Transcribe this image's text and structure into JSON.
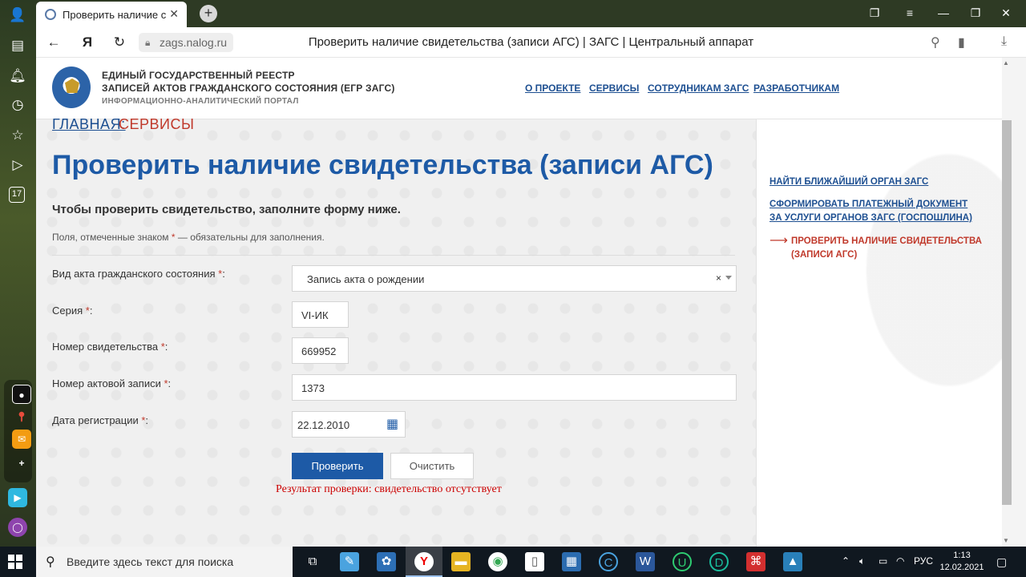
{
  "browser": {
    "tab_title": "Проверить наличие св",
    "tab_close": "✕",
    "url": "zags.nalog.ru",
    "page_title": "Проверить наличие свидетельства (записи АГС) | ЗАГС | Центральный аппарат",
    "new_tab": "+"
  },
  "header": {
    "brand_line1": "ЕДИНЫЙ ГОСУДАРСТВЕННЫЙ РЕЕСТР",
    "brand_line2": "ЗАПИСЕЙ АКТОВ ГРАЖДАНСКОГО СОСТОЯНИЯ (ЕГР ЗАГС)",
    "brand_line3": "ИНФОРМАЦИОННО-АНАЛИТИЧЕСКИЙ ПОРТАЛ",
    "nav": [
      "О ПРОЕКТЕ",
      "СЕРВИСЫ",
      "СОТРУДНИКАМ ЗАГС",
      "РАЗРАБОТЧИКАМ"
    ]
  },
  "breadcrumb": {
    "home": "ГЛАВНАЯ:",
    "current": "СЕРВИСЫ"
  },
  "main": {
    "title": "Проверить наличие свидетельства (записи АГС)",
    "lead": "Чтобы проверить свидетельство, заполните форму ниже.",
    "note_before": "Поля, отмеченные знаком ",
    "note_star": "*",
    "note_after": " — обязательны для заполнения."
  },
  "form": {
    "star": "*",
    "act_type_label": "Вид акта гражданского состояния ",
    "act_type_value": "Запись акта о рождении",
    "act_type_clear": "×",
    "series_label": "Серия ",
    "series_value": "VI-ИК",
    "number_label": "Номер свидетельства ",
    "number_value": "669952",
    "record_label": "Номер актовой записи ",
    "record_value": "1373",
    "date_label": "Дата регистрации ",
    "date_value": "22.12.2010",
    "submit_label": "Проверить",
    "reset_label": "Очистить",
    "result": "Результат проверки: свидетельство отсутствует"
  },
  "sidebar": {
    "link1": "НАЙТИ БЛИЖАЙШИЙ ОРГАН ЗАГС",
    "link2": "СФОРМИРОВАТЬ ПЛАТЕЖНЫЙ ДОКУМЕНТ ЗА УСЛУГИ ОРГАНОВ ЗАГС (ГОСПОШЛИНА)",
    "link3": "ПРОВЕРИТЬ НАЛИЧИЕ СВИДЕТЕЛЬСТВА (ЗАПИСИ АГС)",
    "arrow": "⟶"
  },
  "taskbar": {
    "search_placeholder": "Введите здесь текст для поиска",
    "lang": "РУС",
    "time": "1:13",
    "date": "12.02.2021"
  },
  "rail": {
    "calendar_day": "17"
  },
  "colors": {
    "brand_blue": "#1d5aa6",
    "link_blue": "#1d4f91",
    "accent_red": "#c0392b",
    "error_red": "#cc0000"
  }
}
